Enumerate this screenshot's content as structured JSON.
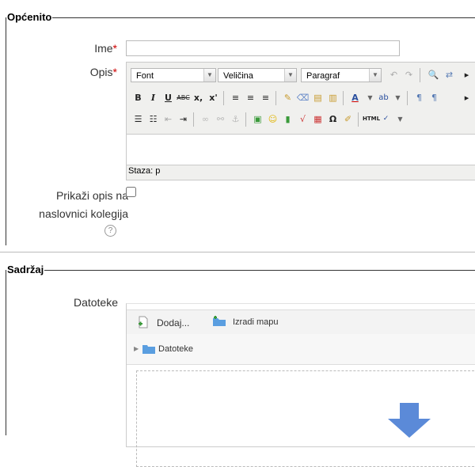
{
  "section1": {
    "legend": "Općenito"
  },
  "name": {
    "label": "Ime",
    "required": "*",
    "value": ""
  },
  "description": {
    "label": "Opis",
    "required": "*",
    "toolbar": {
      "font_select": "Font",
      "size_select": "Veličina",
      "format_select": "Paragraf"
    },
    "path_label": "Staza: p"
  },
  "show_description": {
    "label_line1": "Prikaži opis na",
    "label_line2": "naslovnici kolegija",
    "help_icon_glyph": "?"
  },
  "section2": {
    "legend": "Sadržaj"
  },
  "files": {
    "label": "Datoteke",
    "add_label": "Dodaj...",
    "mkdir_label": "Izradi mapu",
    "folder_label": "Datoteke"
  },
  "colors": {
    "required": "#cc0000",
    "folder": "#5a9ee0",
    "drop_arrow": "#4f80d3"
  }
}
